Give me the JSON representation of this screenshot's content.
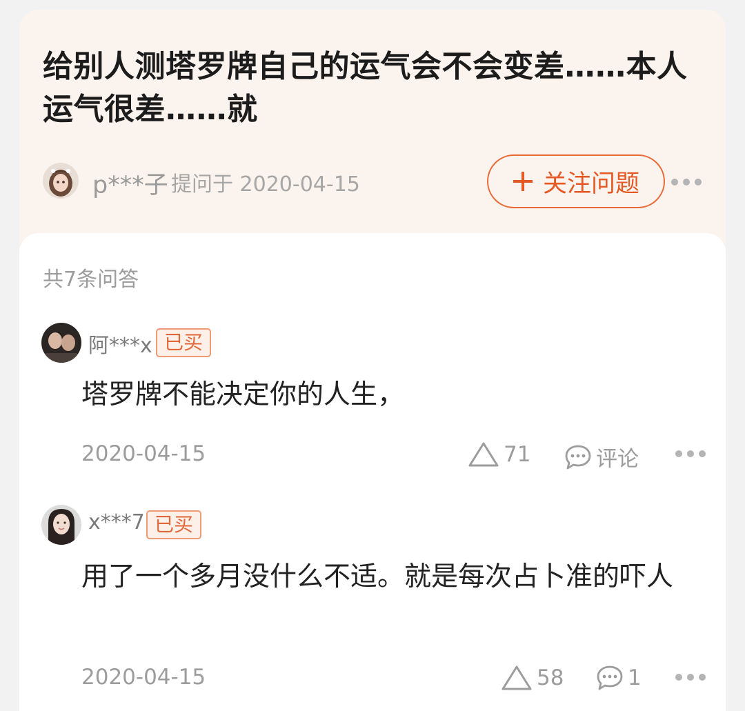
{
  "question": {
    "title": "给别人测塔罗牌自己的运气会不会变差……本人运气很差……就",
    "asker_name": "p***子",
    "asked_label": "提问于 2020-04-15",
    "follow_label": "关注问题"
  },
  "answers_header": {
    "count_label": "共7条问答"
  },
  "answers": [
    {
      "user_name": "阿***x",
      "badge": "已买",
      "content": "塔罗牌不能决定你的人生，",
      "date": "2020-04-15",
      "likes": "71",
      "comment_label": "评论"
    },
    {
      "user_name": "x***7",
      "badge": "已买",
      "content": "用了一个多月没什么不适。就是每次占卜准的吓人",
      "date": "2020-04-15",
      "likes": "58",
      "comment_label": "1"
    }
  ],
  "icons": {
    "plus": "plus-icon",
    "more": "more-dots-icon",
    "like": "triangle-like-icon",
    "comment": "speech-bubble-icon"
  },
  "colors": {
    "accent": "#e55a24",
    "header_bg": "#fbf3ee",
    "badge_bg": "#fdf0e9",
    "muted_text": "#9c9c9c"
  }
}
